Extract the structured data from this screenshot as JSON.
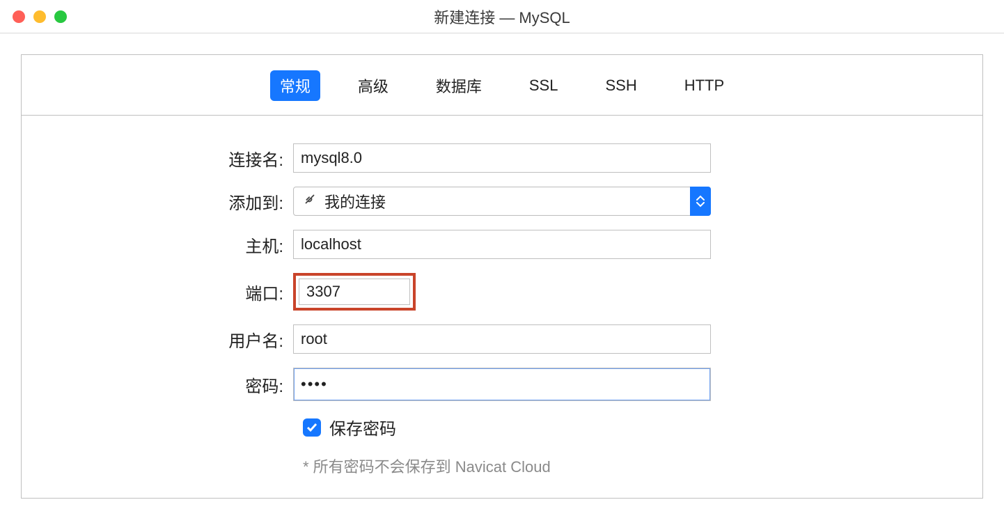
{
  "window": {
    "title": "新建连接 — MySQL"
  },
  "tabs": {
    "general": "常规",
    "advanced": "高级",
    "database": "数据库",
    "ssl": "SSL",
    "ssh": "SSH",
    "http": "HTTP",
    "active": "general"
  },
  "labels": {
    "connection_name": "连接名:",
    "add_to": "添加到:",
    "host": "主机:",
    "port": "端口:",
    "username": "用户名:",
    "password": "密码:"
  },
  "values": {
    "connection_name": "mysql8.0",
    "add_to": "我的连接",
    "host": "localhost",
    "port": "3307",
    "username": "root",
    "password": "••••"
  },
  "checkbox": {
    "save_password_label": "保存密码",
    "save_password_checked": true
  },
  "note": "* 所有密码不会保存到 Navicat Cloud",
  "colors": {
    "accent": "#1677ff",
    "highlight_box": "#c9442a",
    "focus_ring": "#93b7f3"
  }
}
